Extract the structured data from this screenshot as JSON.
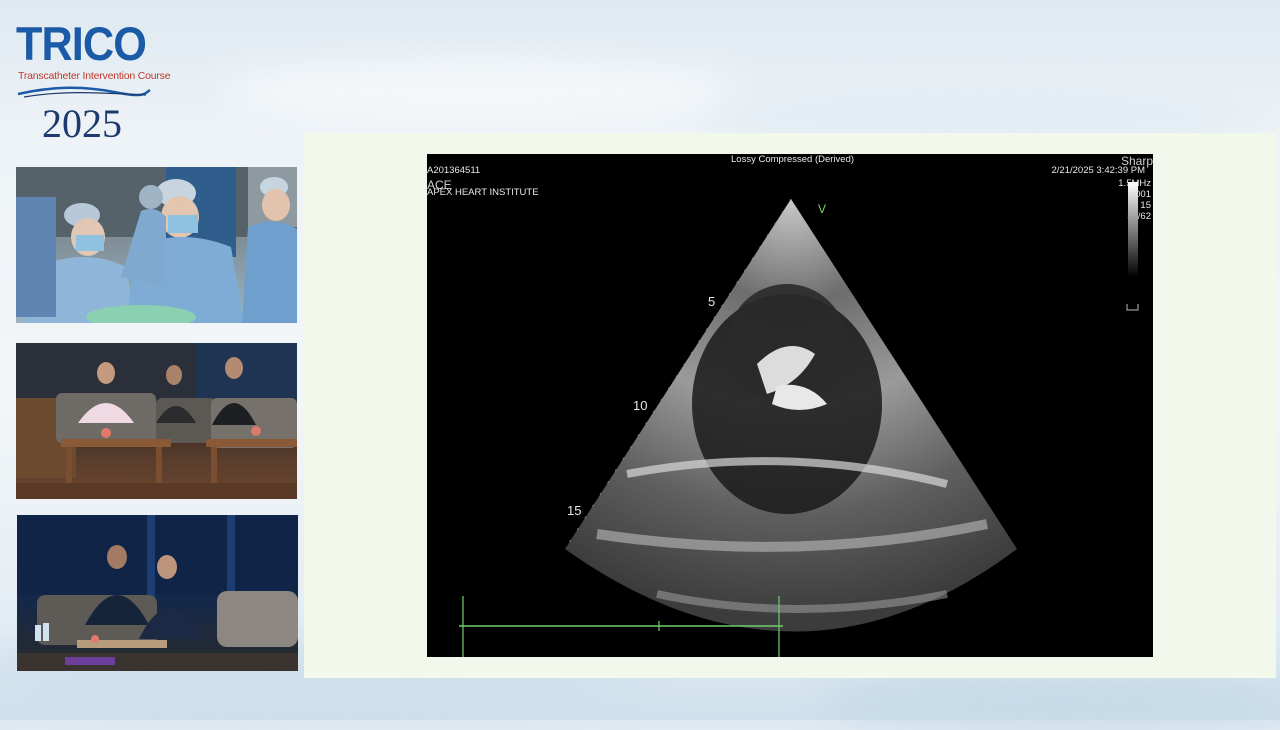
{
  "logo": {
    "brand": "TRICO",
    "subtitle": "Transcatheter Intervention Course",
    "year": "2025"
  },
  "camera_feeds": [
    {
      "id": "cath-lab",
      "subject": "operators in scrubs and masks"
    },
    {
      "id": "panel-1",
      "subject": "panelists seated on sofas"
    },
    {
      "id": "panel-2",
      "subject": "panelists seated"
    }
  ],
  "echo": {
    "header_center": "Lossy Compressed (Derived)",
    "id_label": "A201364511",
    "overlay_label": "ACE",
    "institution": "APEX HEART INSTITUTE",
    "timestamp": "2/21/2025 3:42:39 PM",
    "preset": "Sharp",
    "params": [
      "1.5MHz",
      "0001",
      "15",
      "33/62"
    ],
    "orientation_marker": "V",
    "depth_labels": [
      "5",
      "10",
      "15"
    ],
    "scale_color": "#6fce6f"
  },
  "colors": {
    "brand_blue": "#1b5aa6",
    "brand_red": "#c0392b",
    "stage_bg": "#f2f8ec"
  }
}
